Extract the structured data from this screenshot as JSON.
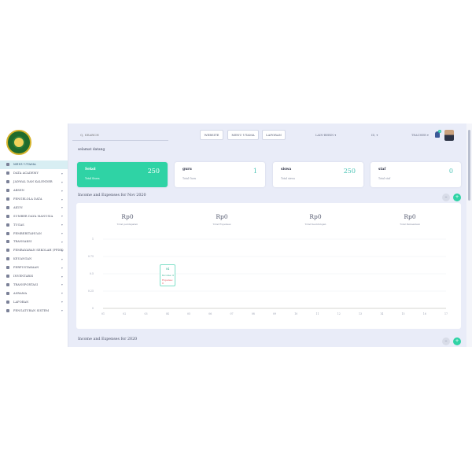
{
  "sidebar": {
    "items": [
      {
        "label": "MENU UTAMA",
        "active": true,
        "chevron": false
      },
      {
        "label": "DATA ACADEMY",
        "chevron": true
      },
      {
        "label": "JADWAL DAN KALENDER",
        "chevron": true
      },
      {
        "label": "ABSEN",
        "chevron": true
      },
      {
        "label": "PENGELOLA DATA",
        "chevron": true
      },
      {
        "label": "AKUN",
        "chevron": true
      },
      {
        "label": "SUMBER DAYA MANUSIA",
        "chevron": true
      },
      {
        "label": "TUGAS",
        "chevron": true
      },
      {
        "label": "PEMBERITAHUAN",
        "chevron": true
      },
      {
        "label": "TRANSAKSI",
        "chevron": true
      },
      {
        "label": "PEMBAYARAN SEKOLAH (PPDB)",
        "chevron": true
      },
      {
        "label": "KEUANGAN",
        "chevron": true
      },
      {
        "label": "PERPUSTAKAAN",
        "chevron": true
      },
      {
        "label": "INVENTARIS",
        "chevron": true
      },
      {
        "label": "TRANSPORTASI",
        "chevron": true
      },
      {
        "label": "ASRAMA",
        "chevron": true
      },
      {
        "label": "LAPORAN",
        "chevron": true
      },
      {
        "label": "PENGATURAN SISTEM",
        "chevron": true
      }
    ]
  },
  "topbar": {
    "search_placeholder": "Q, SEARCH",
    "buttons": [
      "WEBSITE",
      "MENU UTAMA",
      "LAPORAN"
    ],
    "academic_year": "LAIN-BEBIN ▾",
    "language": "ID, ▾",
    "user": "TEACHER ▾",
    "notification_count": "3"
  },
  "welcome": "selamat datang",
  "cards": [
    {
      "title": "Sekol",
      "sub": "Total Siswa",
      "value": "250",
      "primary": true
    },
    {
      "title": "guru",
      "sub": "Total Guru",
      "value": "1",
      "primary": false
    },
    {
      "title": "siswa",
      "sub": "Total siswa",
      "value": "250",
      "primary": false
    },
    {
      "title": "staf",
      "sub": "Total staf",
      "value": "0",
      "primary": false
    }
  ],
  "section1_title": "Income and Expenses for Nov 2020",
  "section2_title": "Income and Expenses for 2020",
  "metrics": [
    {
      "value": "Rp0",
      "label": "Total pendapatan"
    },
    {
      "value": "Rp0",
      "label": "Total Expenses"
    },
    {
      "value": "Rp0",
      "label": "Total Keuntungan"
    },
    {
      "value": "Rp0",
      "label": "Total Pemasukan"
    }
  ],
  "tooltip": {
    "title": "04",
    "income": "Income: 0",
    "expense": "Expense: 0"
  },
  "colors": {
    "accent": "#2fd3a5",
    "expense": "#e0545a"
  },
  "chart_data": {
    "type": "line",
    "categories": [
      "01",
      "02",
      "03",
      "04",
      "05",
      "06",
      "07",
      "08",
      "09",
      "10",
      "11",
      "12",
      "13",
      "14",
      "15",
      "16",
      "17"
    ],
    "series": [
      {
        "values": [
          0,
          0,
          0,
          0,
          0,
          0,
          0,
          0,
          0,
          0,
          0,
          0,
          0,
          0,
          0,
          0,
          0
        ]
      },
      {
        "values": [
          0,
          0,
          0,
          0,
          0,
          0,
          0,
          0,
          0,
          0,
          0,
          0,
          0,
          0,
          0,
          0,
          0
        ]
      }
    ],
    "y_ticks": [
      "1",
      "0.75",
      "0.5",
      "0.25",
      "0"
    ],
    "ylim": [
      0,
      1
    ],
    "grid": true
  }
}
